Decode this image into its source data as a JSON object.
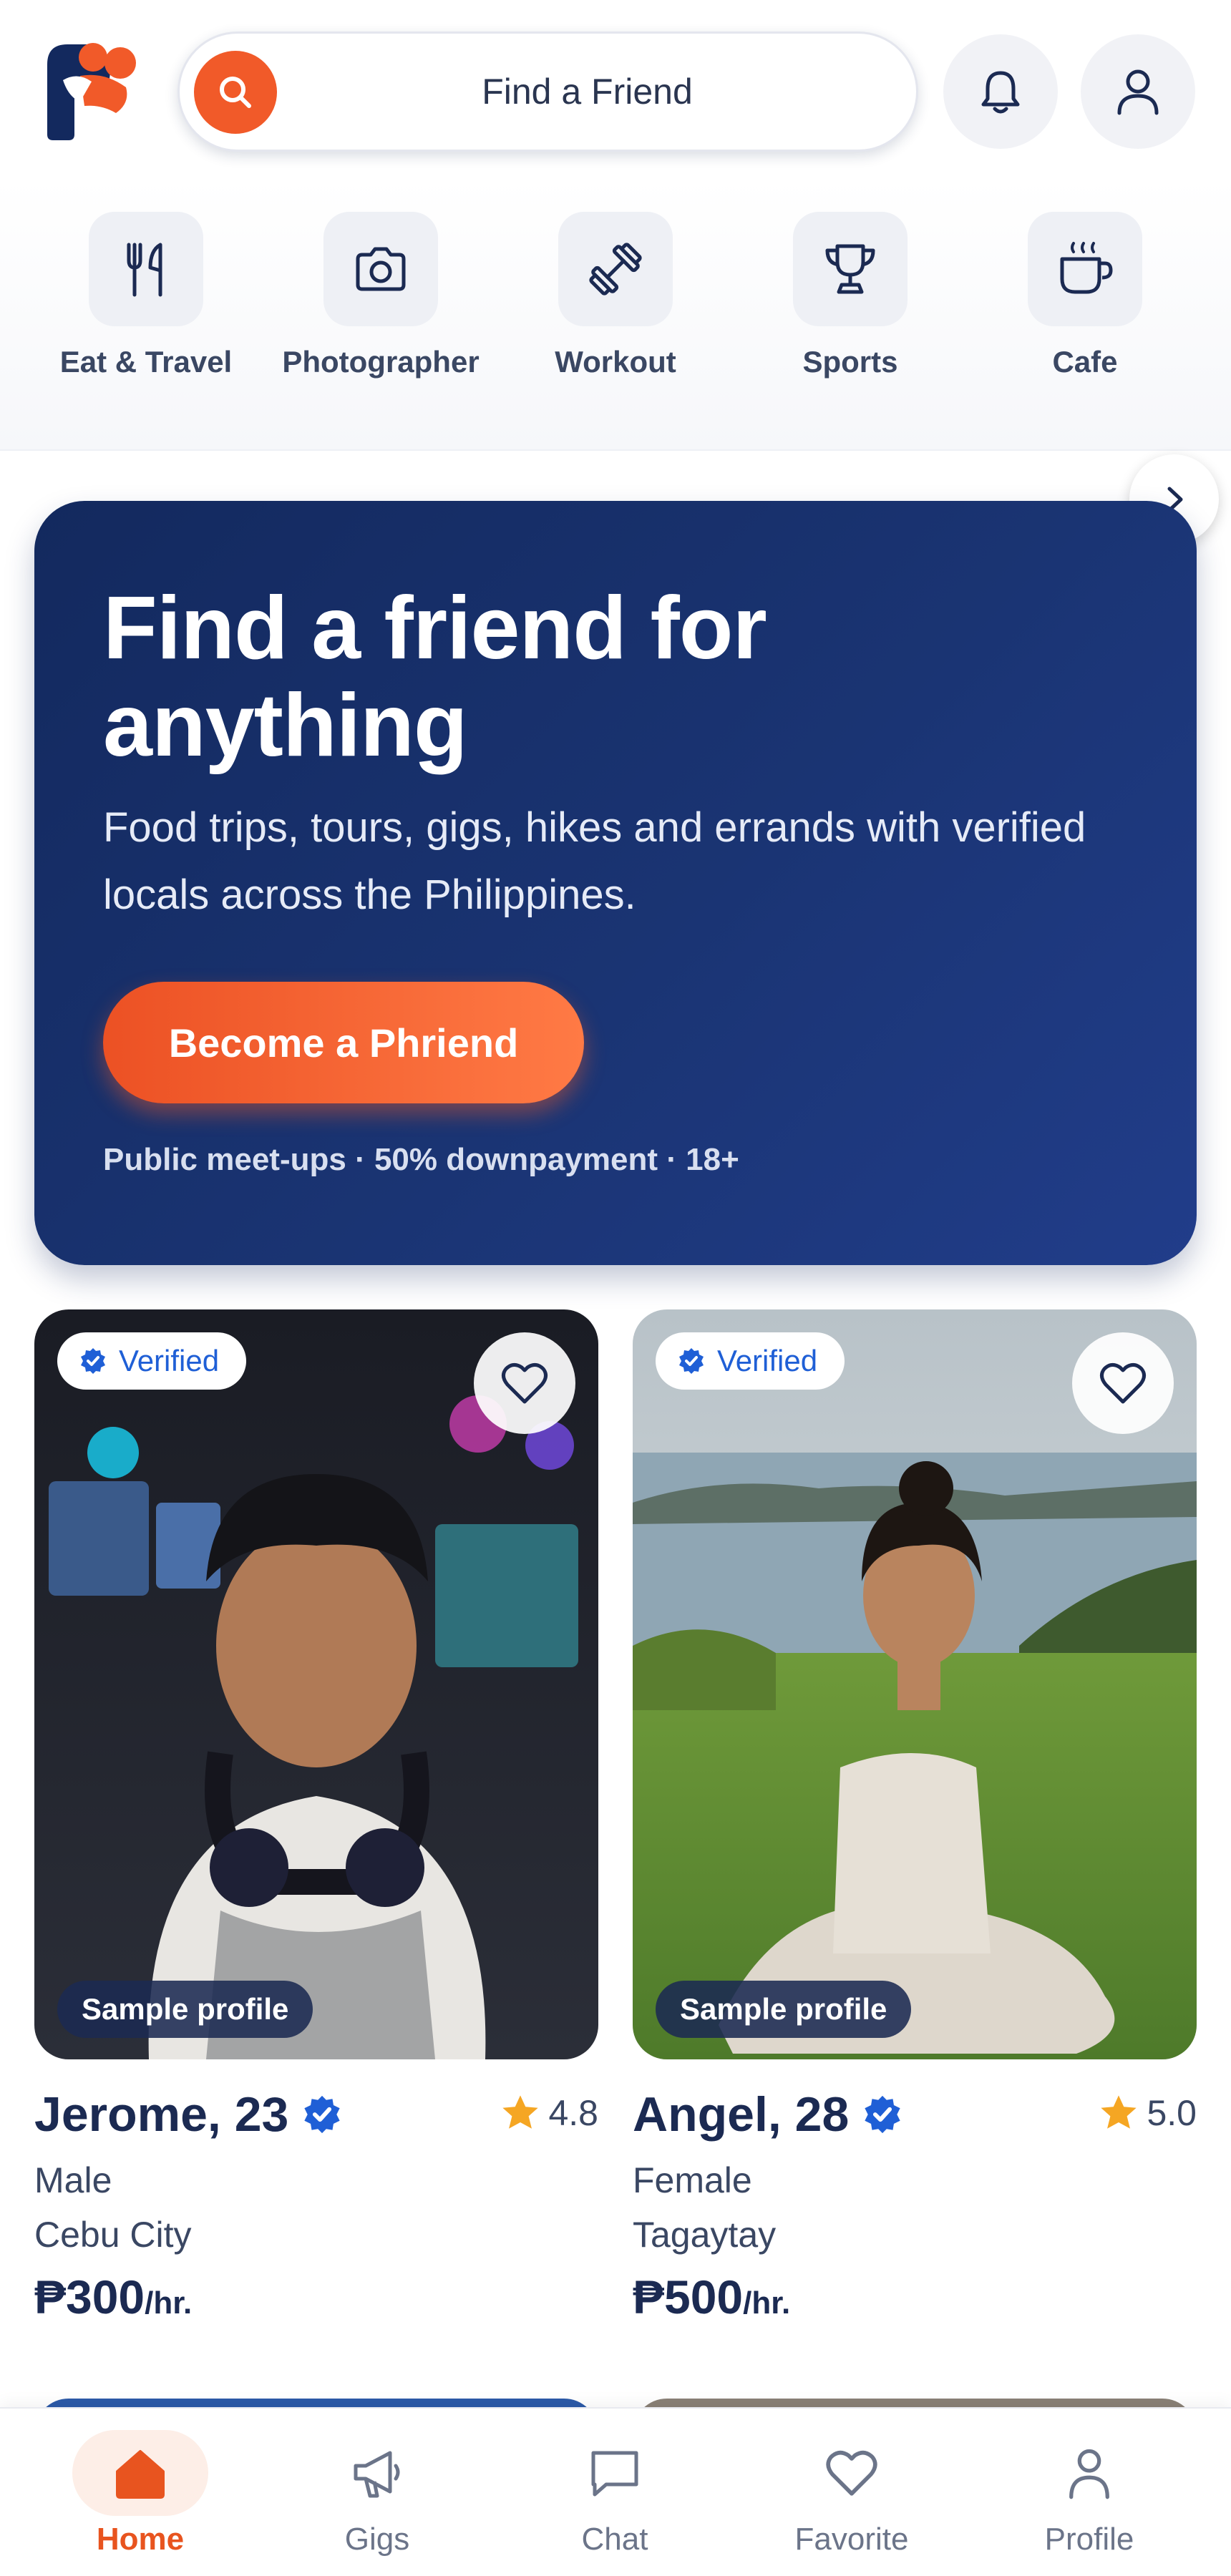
{
  "header": {
    "search_placeholder": "Find a Friend"
  },
  "categories": [
    {
      "label": "Eat & Travel",
      "icon": "fork-knife-icon"
    },
    {
      "label": "Photographer",
      "icon": "camera-icon"
    },
    {
      "label": "Workout",
      "icon": "dumbbell-icon"
    },
    {
      "label": "Sports",
      "icon": "trophy-icon"
    },
    {
      "label": "Cafe",
      "icon": "coffee-cup-icon"
    }
  ],
  "hero": {
    "title": "Find a friend for anything",
    "subtitle": "Food trips, tours, gigs, hikes and errands with verified locals across the Philippines.",
    "cta": "Become a Phriend",
    "note": "Public meet-ups · 50% downpayment · 18+"
  },
  "profiles": [
    {
      "verified_label": "Verified",
      "sample_label": "Sample profile",
      "name": "Jerome, 23",
      "rating": "4.8",
      "gender": "Male",
      "city": "Cebu City",
      "price": "₱300",
      "unit": "/hr."
    },
    {
      "verified_label": "Verified",
      "sample_label": "Sample profile",
      "name": "Angel, 28",
      "rating": "5.0",
      "gender": "Female",
      "city": "Tagaytay",
      "price": "₱500",
      "unit": "/hr."
    }
  ],
  "nav": [
    {
      "label": "Home",
      "icon": "home-icon",
      "active": true
    },
    {
      "label": "Gigs",
      "icon": "megaphone-icon",
      "active": false
    },
    {
      "label": "Chat",
      "icon": "chat-bubble-icon",
      "active": false
    },
    {
      "label": "Favorite",
      "icon": "heart-icon",
      "active": false
    },
    {
      "label": "Profile",
      "icon": "person-icon",
      "active": false
    }
  ],
  "colors": {
    "brand_orange": "#f15a29",
    "brand_navy": "#1b2a52",
    "hero_bg": "#1a3473",
    "verified_blue": "#1f5fd6",
    "star_gold": "#f5a623"
  }
}
